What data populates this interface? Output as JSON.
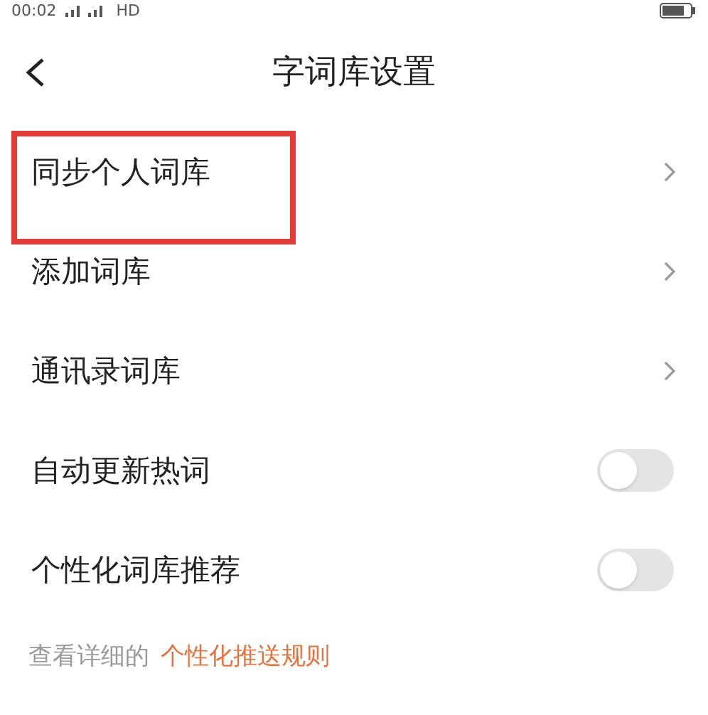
{
  "status_bar": {
    "time": "00:02",
    "network": "HD"
  },
  "header": {
    "title": "字词库设置"
  },
  "rows": [
    {
      "kind": "link",
      "label": "同步个人词库",
      "highlighted": true
    },
    {
      "kind": "link",
      "label": "添加词库",
      "highlighted": false
    },
    {
      "kind": "link",
      "label": "通讯录词库",
      "highlighted": false
    },
    {
      "kind": "toggle",
      "label": "自动更新热词",
      "on": false,
      "highlighted": false
    },
    {
      "kind": "toggle",
      "label": "个性化词库推荐",
      "on": false,
      "highlighted": false
    }
  ],
  "footer": {
    "text": "查看详细的",
    "link": "个性化推送规则"
  }
}
